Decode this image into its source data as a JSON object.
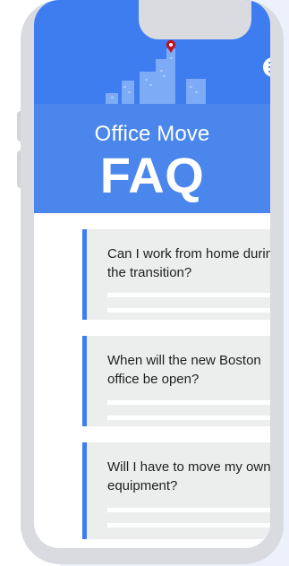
{
  "header": {
    "title_line": "Office Move",
    "title_big": "FAQ"
  },
  "icons": {
    "menu": "menu-icon",
    "skyline": "skyline-icon",
    "location": "location-pin-icon"
  },
  "faq": {
    "items": [
      {
        "question": "Can I work from home during the transition?"
      },
      {
        "question": "When will the new Boston office be open?"
      },
      {
        "question": "Will I have to move my own equipment?"
      }
    ]
  },
  "colors": {
    "header_dark": "#3d7df0",
    "header_light": "#4a86eb",
    "accent": "#3d7df0",
    "card_bg": "#eceded",
    "pin": "#c1121f"
  }
}
